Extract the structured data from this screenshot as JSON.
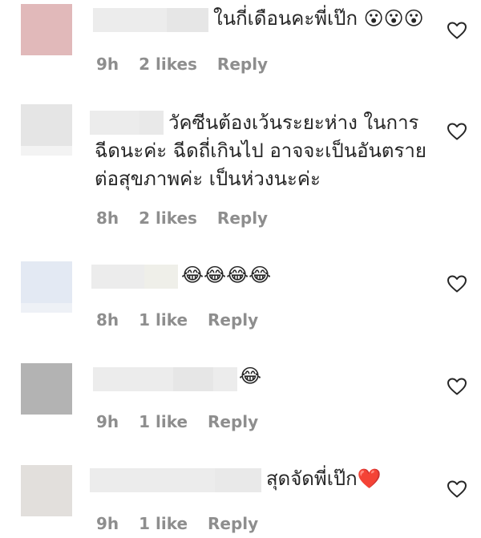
{
  "colors": {
    "meta_text": "#8e8e8e",
    "body_text": "#262626",
    "heart_outline": "#262626",
    "redacted_name": "#ececec"
  },
  "comments": [
    {
      "avatar_color": "#e1b9ba",
      "text_lines": [
        "ในกี่เดือนคะพี่เป๊ก 😮😮😮"
      ],
      "time": "9h",
      "likes": "2 likes",
      "reply": "Reply",
      "heart_icon": "heart-outline-icon"
    },
    {
      "avatar_color": "#e5e5e5",
      "text_lines": [
        "วัคซีนต้องเว้นระยะห่าง ในการ",
        "ฉีดนะค่ะ ฉีดถี่เกินไป อาจจะเป็นอันตราย",
        "ต่อสุขภาพค่ะ เป็นห่วงนะค่ะ"
      ],
      "time": "8h",
      "likes": "2 likes",
      "reply": "Reply",
      "heart_icon": "heart-outline-icon"
    },
    {
      "avatar_color": "#e3e9f3",
      "text_lines": [
        "😂😂😂😂"
      ],
      "time": "8h",
      "likes": "1 like",
      "reply": "Reply",
      "heart_icon": "heart-outline-icon"
    },
    {
      "avatar_color": "#b3b3b3",
      "text_lines": [
        "😂"
      ],
      "time": "9h",
      "likes": "1 like",
      "reply": "Reply",
      "heart_icon": "heart-outline-icon"
    },
    {
      "avatar_color": "#e2dfdc",
      "text_lines": [
        "สุดจัดพี่เป๊ก❤️"
      ],
      "time": "9h",
      "likes": "1 like",
      "reply": "Reply",
      "heart_icon": "heart-outline-icon"
    }
  ]
}
